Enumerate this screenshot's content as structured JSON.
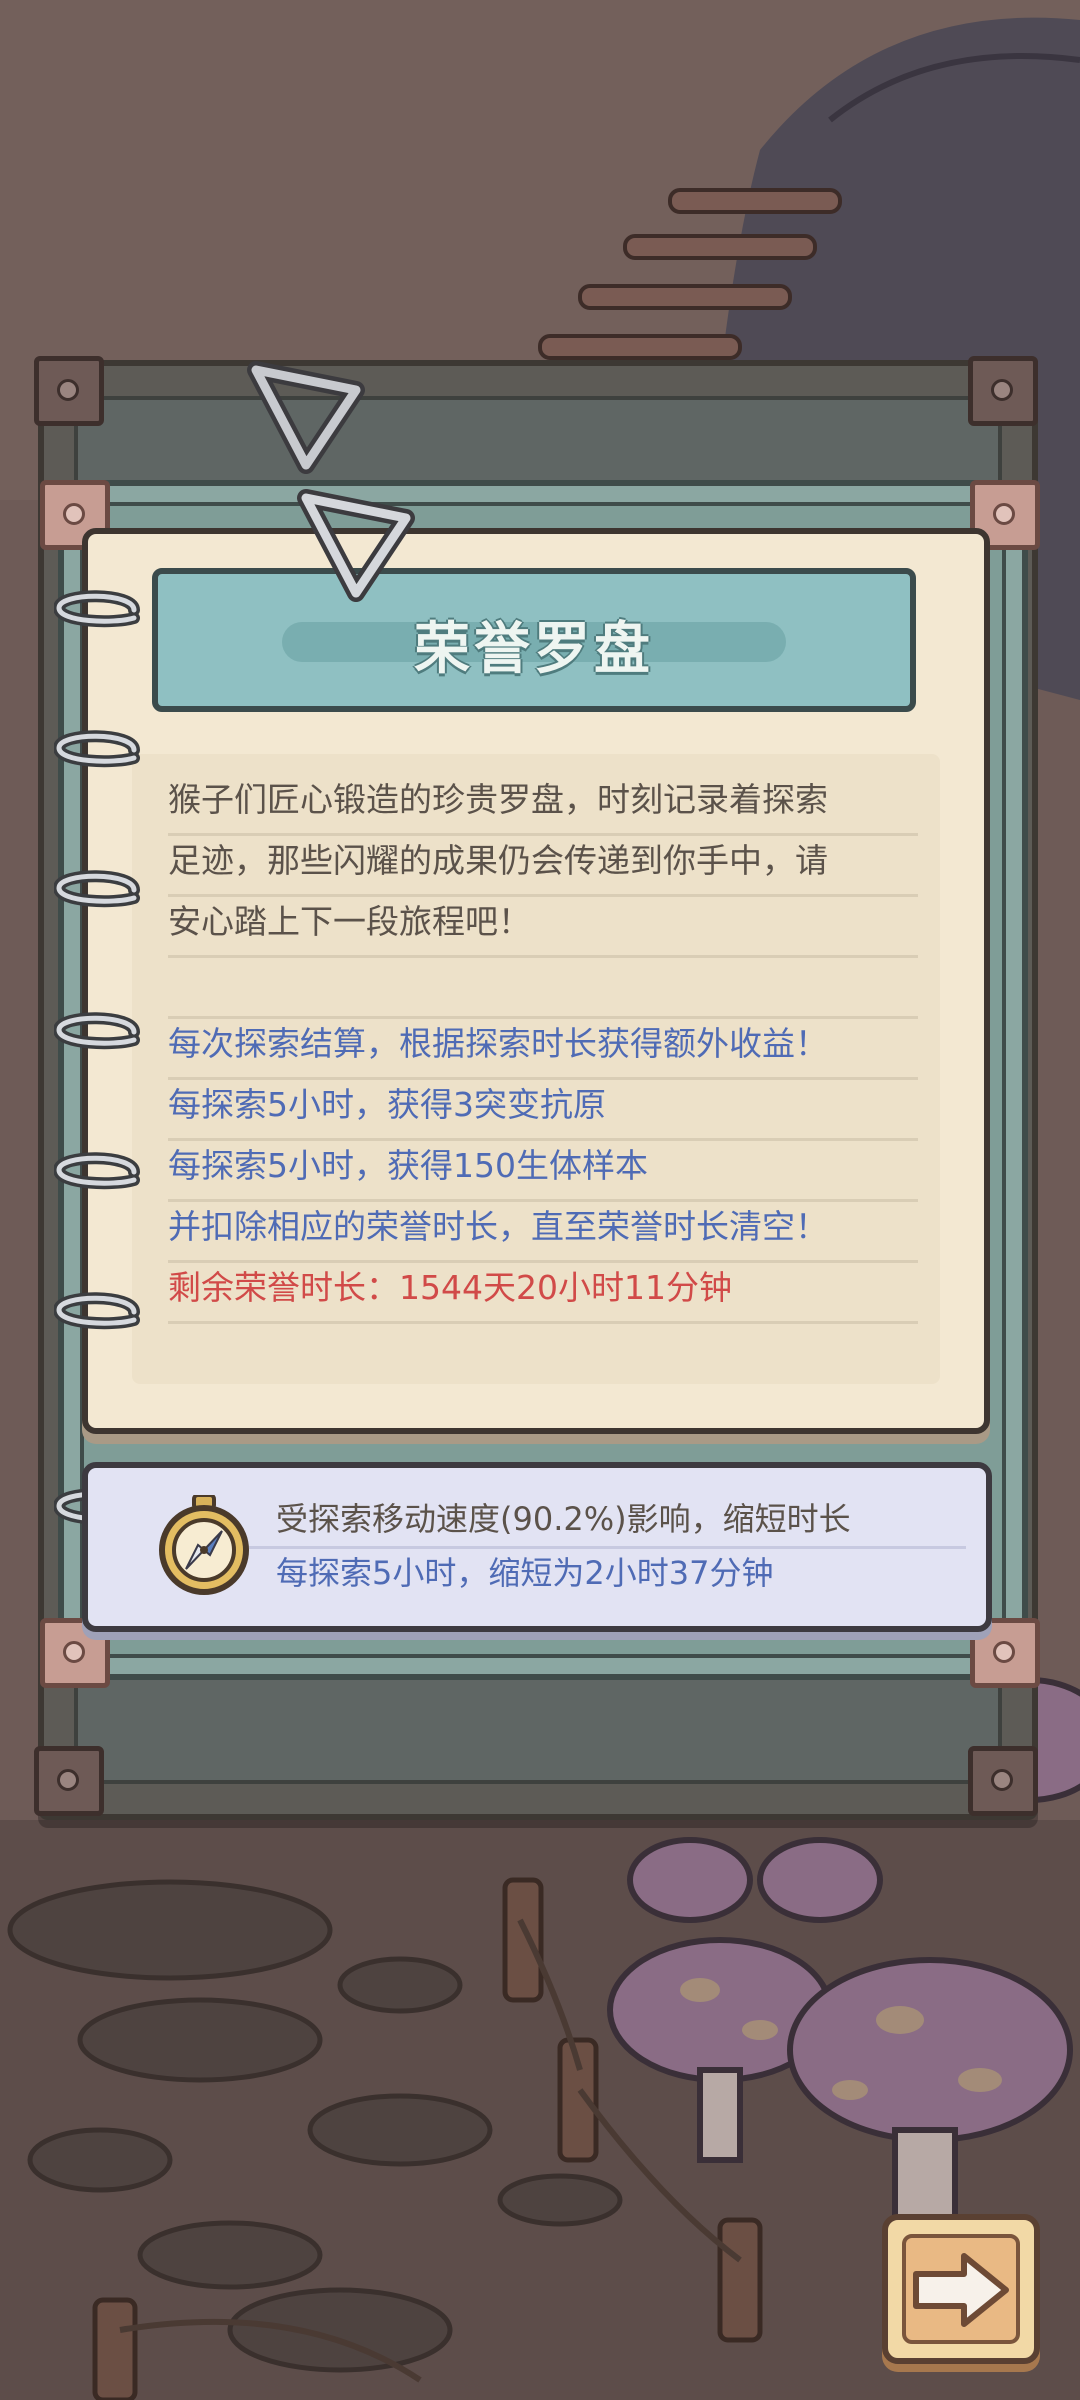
{
  "title": "荣誉罗盘",
  "description": {
    "lines": [
      "猴子们匠心锻造的珍贵罗盘，时刻记录着探索",
      "足迹，那些闪耀的成果仍会传递到你手中，请",
      "安心踏上下一段旅程吧！"
    ]
  },
  "rewards": {
    "line1": "每次探索结算，根据探索时长获得额外收益！",
    "line2": "每探索5小时，获得3突变抗原",
    "line3": "每探索5小时，获得150生体样本",
    "line4": "并扣除相应的荣誉时长，直至荣誉时长清空！",
    "remaining": "剩余荣誉时长：1544天20小时11分钟"
  },
  "speed_info": {
    "line1": "受探索移动速度(90.2%)影响，缩短时长",
    "line2": "每探索5小时，缩短为2小时37分钟"
  },
  "colors": {
    "blue_text": "#4f6bb5",
    "red_text": "#d14a48",
    "normal_text": "#5b524a",
    "title_bar": "#8fc0c2",
    "parchment": "#f3e8d2"
  },
  "icons": {
    "compass": "compass-icon",
    "next": "arrow-right-icon"
  }
}
